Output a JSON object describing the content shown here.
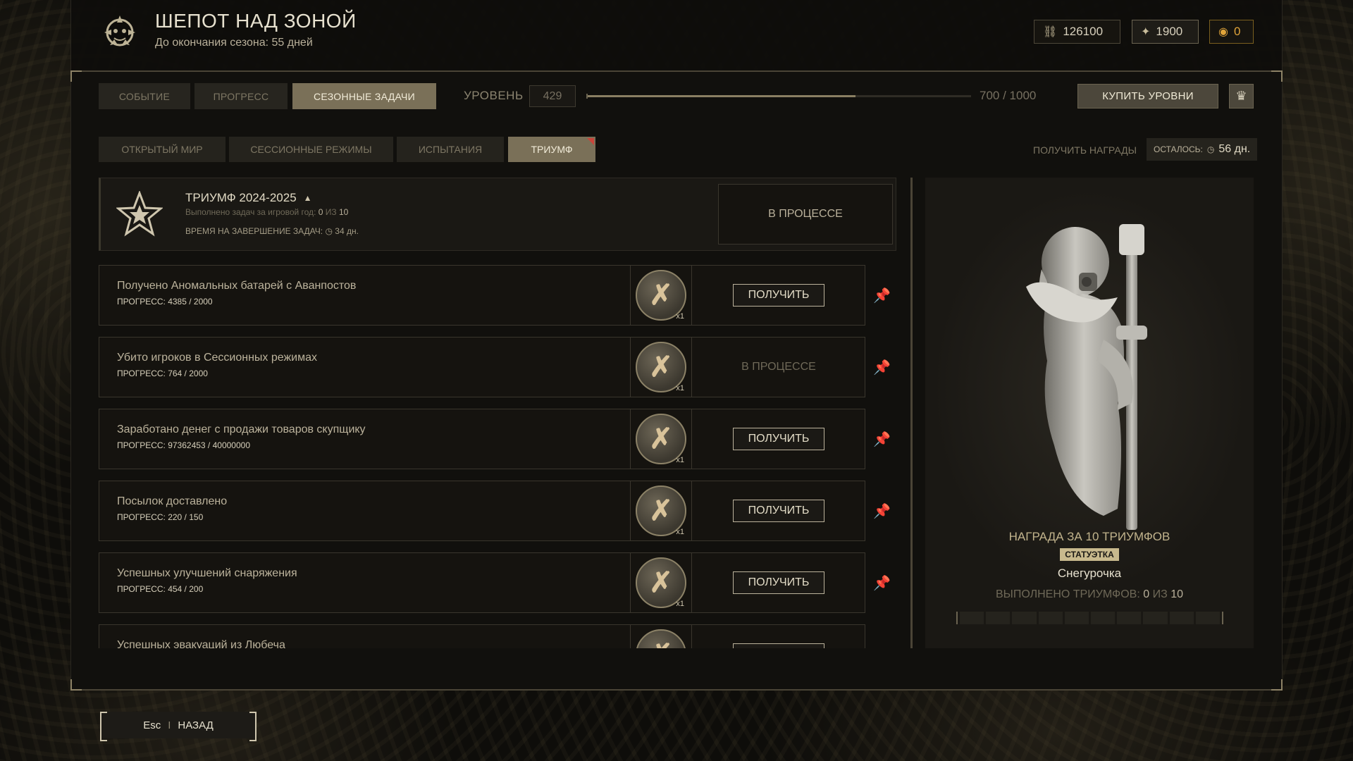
{
  "header": {
    "title": "ШЕПОТ НАД ЗОНОЙ",
    "subtitle": "До окончания сезона: 55 дней",
    "currencies": [
      {
        "icon": "link-icon",
        "value": "126100"
      },
      {
        "icon": "crystal-icon",
        "value": "1900"
      },
      {
        "icon": "coin-icon",
        "value": "0"
      }
    ]
  },
  "tabs": [
    "СОБЫТИЕ",
    "ПРОГРЕСС",
    "СЕЗОННЫЕ ЗАДАЧИ"
  ],
  "active_tab": "СЕЗОННЫЕ ЗАДАЧИ",
  "level": {
    "label": "УРОВЕНЬ",
    "value": "429",
    "progress_text": "700 / 1000",
    "progress_fraction": 0.7
  },
  "buy_levels_label": "КУПИТЬ УРОВНИ",
  "subtabs": [
    "ОТКРЫТЫЙ МИР",
    "СЕССИОННЫЕ РЕЖИМЫ",
    "ИСПЫТАНИЯ",
    "ТРИУМФ"
  ],
  "active_subtab": "ТРИУМФ",
  "rewards_label": "ПОЛУЧИТЬ НАГРАДЫ",
  "remaining": {
    "label": "ОСТАЛОСЬ:",
    "value": "56 дн."
  },
  "triumph": {
    "title": "ТРИУМФ 2024-2025",
    "sub_label": "Выполнено задач за игровой год:",
    "done": "0",
    "of_word": "ИЗ",
    "total": "10",
    "time_label": "ВРЕМЯ НА ЗАВЕРШЕНИЕ ЗАДАЧ:",
    "time_value": "34 дн.",
    "status": "В ПРОЦЕССЕ"
  },
  "tasks": [
    {
      "name": "Получено Аномальных батарей с Аванпостов",
      "progress": "ПРОГРЕСС: 4385 / 2000",
      "qty": "x1",
      "action": "ПОЛУЧИТЬ",
      "claimable": true
    },
    {
      "name": "Убито игроков в Сессионных режимах",
      "progress": "ПРОГРЕСС: 764 / 2000",
      "qty": "x1",
      "action": "В ПРОЦЕССЕ",
      "claimable": false
    },
    {
      "name": "Заработано денег с продажи товаров скупщику",
      "progress": "ПРОГРЕСС: 97362453 / 40000000",
      "qty": "x1",
      "action": "ПОЛУЧИТЬ",
      "claimable": true
    },
    {
      "name": "Посылок доставлено",
      "progress": "ПРОГРЕСС: 220 / 150",
      "qty": "x1",
      "action": "ПОЛУЧИТЬ",
      "claimable": true
    },
    {
      "name": "Успешных улучшений снаряжения",
      "progress": "ПРОГРЕСС: 454 / 200",
      "qty": "x1",
      "action": "ПОЛУЧИТЬ",
      "claimable": true
    },
    {
      "name": "Успешных эвакуаций из Любеча",
      "progress": "",
      "qty": "",
      "action": "",
      "claimable": true
    }
  ],
  "reward": {
    "title": "НАГРАДА ЗА 10 ТРИУМФОВ",
    "badge": "СТАТУЭТКА",
    "name": "Снегурочка",
    "count_label": "ВЫПОЛНЕНО ТРИУМФОВ:",
    "count_done": "0",
    "count_of": "ИЗ",
    "count_total": "10",
    "segments_total": 10,
    "segments_done": 0
  },
  "footer": {
    "key": "Esc",
    "separator": "I",
    "label": "НАЗАД"
  },
  "colors": {
    "accent": "#7a7058",
    "claim_red": "#c9443a",
    "coin": "#e0a43a"
  }
}
